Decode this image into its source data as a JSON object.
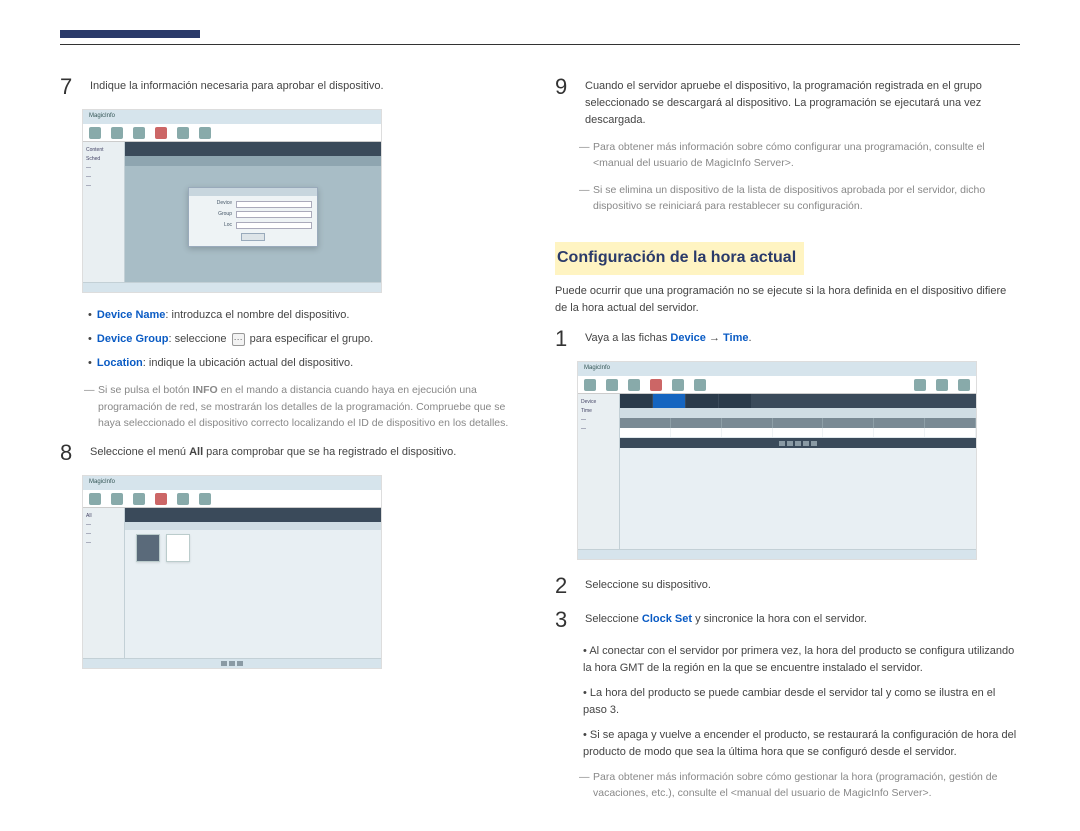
{
  "header": {},
  "left": {
    "step7": {
      "text": "Indique la información necesaria para aprobar el dispositivo.",
      "screenshot_label": "MagicInfo"
    },
    "bullets": {
      "device_name_label": "Device Name",
      "device_name_text": ": introduzca el nombre del dispositivo.",
      "device_group_label": "Device Group",
      "device_group_text_a": ": seleccione",
      "device_group_text_b": " para especificar el grupo.",
      "location_label": "Location",
      "location_text": ": indique la ubicación actual del dispositivo."
    },
    "note7_a": "Si se pulsa el botón ",
    "note7_info": "INFO",
    "note7_b": " en el mando a distancia cuando haya en ejecución una programación de red, se mostrarán los detalles de la programación. Compruebe que se haya seleccionado el dispositivo correcto localizando el ID de dispositivo en los detalles.",
    "step8": {
      "text_a": "Seleccione el menú ",
      "all": "All",
      "text_b": " para comprobar que se ha registrado el dispositivo."
    }
  },
  "right": {
    "step9": {
      "text": "Cuando el servidor apruebe el dispositivo, la programación registrada en el grupo seleccionado se descargará al dispositivo. La programación se ejecutará una vez descargada."
    },
    "note9a": "Para obtener más información sobre cómo configurar una programación, consulte el <manual del usuario de MagicInfo Server>.",
    "note9b": "Si se elimina un dispositivo de la lista de dispositivos aprobada por el servidor, dicho dispositivo se reiniciará para restablecer su configuración.",
    "section_title": "Configuración de la hora actual",
    "intro": "Puede ocurrir que una programación no se ejecute si la hora definida en el dispositivo difiere de la hora actual del servidor.",
    "step1": {
      "text_a": "Vaya a las fichas ",
      "device": "Device",
      "arrow": " → ",
      "time": "Time",
      "text_b": "."
    },
    "step2": {
      "text": "Seleccione su dispositivo."
    },
    "step3": {
      "text_a": "Seleccione ",
      "clock": "Clock Set",
      "text_b": " y sincronice la hora con el servidor."
    },
    "sub": {
      "a": "Al conectar con el servidor por primera vez, la hora del producto se configura utilizando la hora GMT de la región en la que se encuentre instalado el servidor.",
      "b": "La hora del producto se puede cambiar desde el servidor tal y como se ilustra en el paso 3.",
      "c": "Si se apaga y vuelve a encender el producto, se restaurará la configuración de hora del producto de modo que sea la última hora que se configuró desde el servidor."
    },
    "note_final": "Para obtener más información sobre cómo gestionar la hora (programación, gestión de vacaciones, etc.), consulte el <manual del usuario de MagicInfo Server>."
  },
  "nums": {
    "n7": "7",
    "n8": "8",
    "n9": "9",
    "n1": "1",
    "n2": "2",
    "n3": "3"
  }
}
